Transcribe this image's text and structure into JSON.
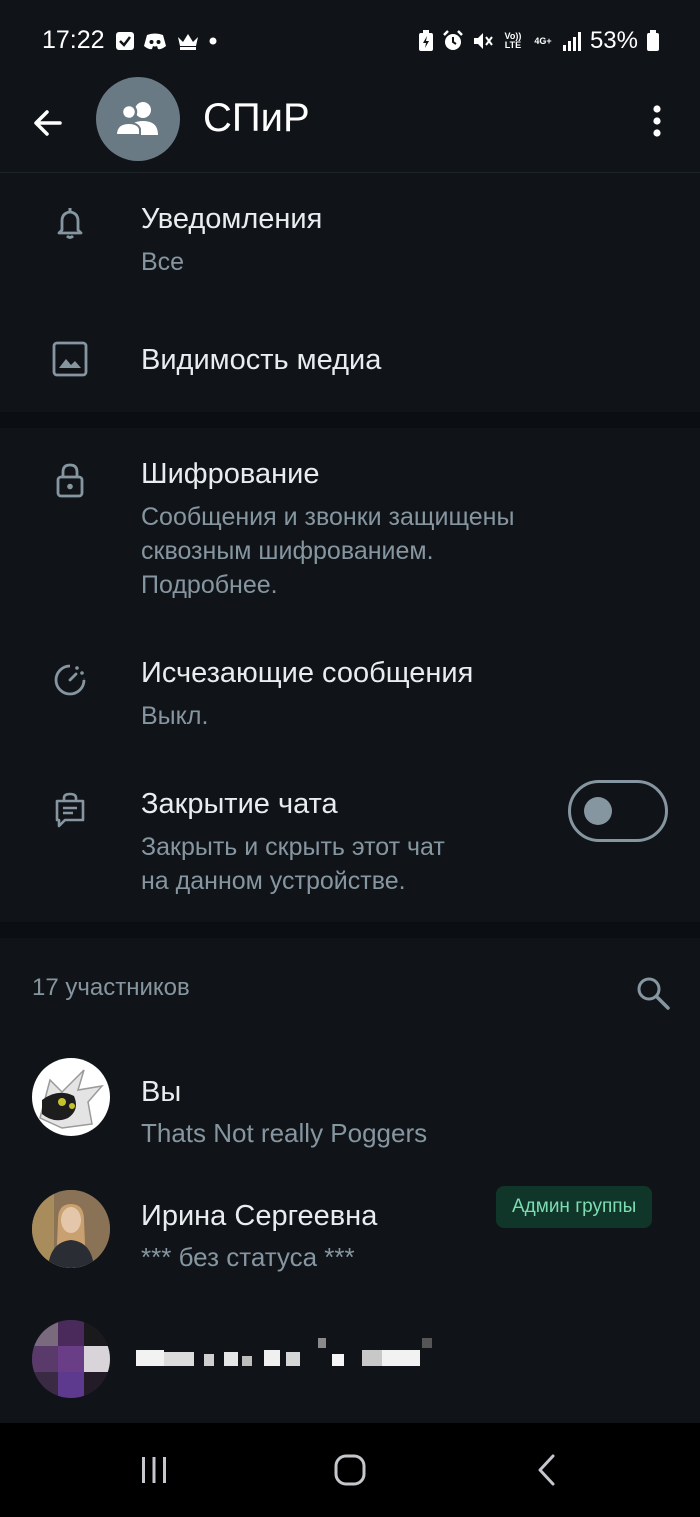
{
  "status_bar": {
    "time": "17:22",
    "battery": "53%",
    "network_volte": "Vo)) LTE",
    "network_gen": "4G+",
    "left_icons": [
      "checkbox-icon",
      "discord-icon",
      "crown-icon",
      "dot-icon"
    ],
    "right_icons": [
      "battery-saver-icon",
      "alarm-icon",
      "mute-icon",
      "volte-icon",
      "4g-icon",
      "signal-icon",
      "battery-icon"
    ]
  },
  "header": {
    "title": "СПиР",
    "avatar_icon": "group-icon",
    "back_icon": "arrow-left-icon",
    "menu_icon": "more-vert-icon"
  },
  "settings": {
    "notifications": {
      "title": "Уведомления",
      "subtitle": "Все",
      "icon": "bell-icon"
    },
    "media_visibility": {
      "title": "Видимость медиа",
      "icon": "image-icon"
    },
    "encryption": {
      "title": "Шифрование",
      "subtitle_line1": "Сообщения и звонки защищены",
      "subtitle_line2": "сквозным шифрованием.",
      "subtitle_line3": "Подробнее.",
      "icon": "lock-icon"
    },
    "disappearing": {
      "title": "Исчезающие сообщения",
      "subtitle": "Выкл.",
      "icon": "timer-icon"
    },
    "chat_lock": {
      "title": "Закрытие чата",
      "subtitle_line1": "Закрыть и скрыть этот чат",
      "subtitle_line2": "на данном устройстве.",
      "icon": "chat-lock-icon",
      "toggle_on": false
    }
  },
  "members": {
    "count_label": "17 участников",
    "search_icon": "search-icon",
    "list": [
      {
        "name": "Вы",
        "status": "Thats Not really Poggers"
      },
      {
        "name": "Ирина Сергеевна",
        "status": "*** без статуса ***",
        "badge": "Админ группы"
      }
    ]
  },
  "colors": {
    "background": "#0b0f13",
    "surface": "#101418",
    "primary_text": "#e9edef",
    "secondary_text": "#8696a0",
    "badge_bg": "#103529",
    "badge_text": "#7ddcb3"
  },
  "nav_bar": {
    "icons": [
      "recents-icon",
      "home-icon",
      "back-icon"
    ]
  }
}
